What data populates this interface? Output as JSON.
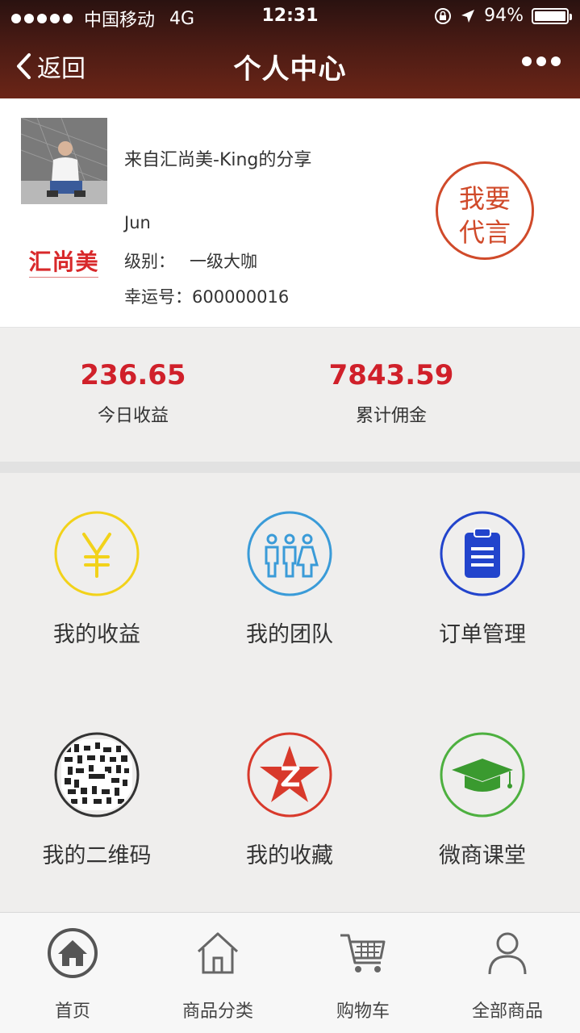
{
  "status_bar": {
    "carrier": "中国移动",
    "network": "4G",
    "time": "12:31",
    "battery": "94%"
  },
  "nav": {
    "back_label": "返回",
    "title": "个人中心"
  },
  "profile": {
    "share_text": "来自汇尚美-King的分享",
    "logo_text": "汇尚美",
    "username": "Jun",
    "level_label": "级别：",
    "level_value": "一级大咖",
    "lucky_label": "幸运号：",
    "lucky_value": "600000016",
    "stamp_line1": "我要",
    "stamp_line2": "代言"
  },
  "stats": {
    "today_value": "236.65",
    "today_label": "今日收益",
    "total_value": "7843.59",
    "total_label": "累计佣金"
  },
  "menu": [
    {
      "label": "我的收益",
      "icon": "yuan-icon",
      "color": "#f2d21a"
    },
    {
      "label": "我的团队",
      "icon": "team-icon",
      "color": "#3a9bd8"
    },
    {
      "label": "订单管理",
      "icon": "clipboard-icon",
      "color": "#2244cc"
    },
    {
      "label": "我的二维码",
      "icon": "qrcode-icon",
      "color": "#333333"
    },
    {
      "label": "我的收藏",
      "icon": "star-icon",
      "color": "#d8392b"
    },
    {
      "label": "微商课堂",
      "icon": "graduation-cap-icon",
      "color": "#4db03f"
    }
  ],
  "tabbar": [
    {
      "label": "首页",
      "icon": "home-icon"
    },
    {
      "label": "商品分类",
      "icon": "house-outline-icon"
    },
    {
      "label": "购物车",
      "icon": "cart-icon"
    },
    {
      "label": "全部商品",
      "icon": "person-icon"
    }
  ]
}
